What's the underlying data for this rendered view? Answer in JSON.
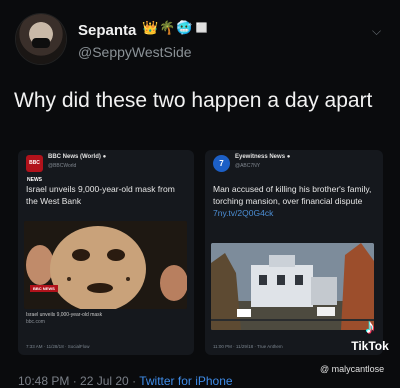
{
  "author": {
    "name": "Sepanta",
    "emoji": "👑🌴🥶◻️",
    "handle": "@SeppyWestSide"
  },
  "tweet_text": "Why did these two happen a day apart",
  "cards": [
    {
      "source_logo": "BBC NEWS",
      "source_name": "BBC News (World)",
      "source_handle": "@BBCWorld",
      "text": "Israel unveils 9,000-year-old mask from the West Bank",
      "badge": "BBC NEWS",
      "caption": "Israel unveils 9,000-year-old mask",
      "caption_source": "bbc.com",
      "footer": "7:33 AM · 11/28/18 · SocialFlow"
    },
    {
      "source_logo": "7",
      "source_name": "Eyewitness News",
      "source_handle": "@ABC7NY",
      "text": "Man accused of killing his brother's family, torching mansion, over financial dispute",
      "link": "7ny.tv/2Q0G4ck",
      "footer": "11:00 PM · 11/29/18 · True Anthem"
    }
  ],
  "watermark": {
    "logo": "♪",
    "brand": "TikTok",
    "user": "@ malycantlose"
  },
  "bottom_meta": {
    "time": "10:48 PM · 22 Jul 20 · ",
    "client": "Twitter for iPhone"
  }
}
